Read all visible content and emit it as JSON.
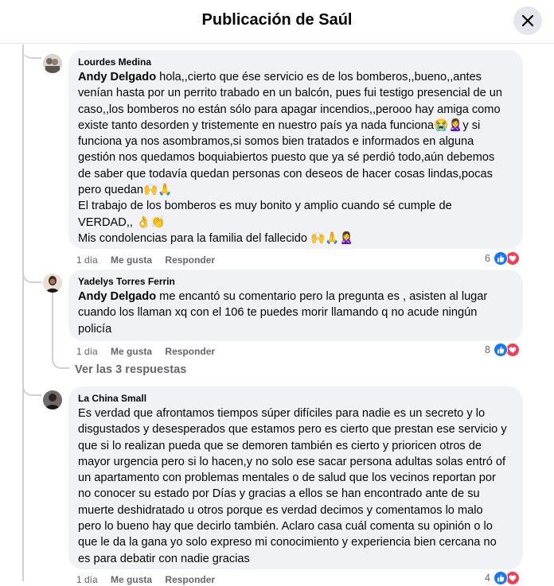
{
  "header": {
    "title": "Publicación de Saúl"
  },
  "comments": [
    {
      "author": "Lourdes Medina",
      "mention": "Andy Delgado",
      "text_lines": [
        " hola,,cierto que ése servicio es de los bomberos,,bueno,,antes",
        "venían hasta por un perrito trabado en un balcón, pues fui testigo presencial de un",
        "caso,,los bomberos no están sólo para apagar incendios,,perooo hay amiga como",
        "existe tanto desorden y tristemente en nuestro país ya nada funciona😭🙎‍♀️y si",
        "funciona ya nos asombramos,si somos bien tratados e informados en alguna",
        "gestión nos quedamos boquiabiertos puesto que ya sé perdió todo,aún debemos",
        "de saber que todavía quedan personas con deseos de hacer cosas lindas,pocas",
        "pero quedan🙌🙏",
        "El trabajo de los bomberos es muy bonito y amplio cuando sé cumple de",
        "VERDAD,, 👌👏",
        "Mis condolencias para la familia del fallecido 🙌🙏🙎‍♀️"
      ],
      "time": "1 día",
      "like_label": "Me gusta",
      "reply_label": "Responder",
      "reaction_count": "6"
    },
    {
      "author": "Yadelys Torres Ferrin",
      "mention": "Andy Delgado",
      "text_lines": [
        " me encantó su comentario pero la pregunta es , asisten al lugar",
        "cuando los llaman xq con el 106 te puedes morir llamando q no acude ningún",
        "policía"
      ],
      "time": "1 día",
      "like_label": "Me gusta",
      "reply_label": "Responder",
      "reaction_count": "8"
    },
    {
      "author": "La China Small",
      "mention": "",
      "text_lines": [
        "Es verdad que afrontamos tiempos súper difíciles para nadie es un secreto y lo",
        "disgustados y desesperados que estamos pero es cierto que prestan ese servicio y",
        "que si lo realizan pueda que se demoren también es cierto y prioricen otros de",
        "mayor urgencia pero si lo hacen,y no solo ese sacar persona adultas solas entró of",
        "un apartamento con problemas mentales o de salud que los vecinos reportan por",
        "no conocer su estado por Días y gracias a ellos se han encontrado ante de su",
        "muerte deshidratado u otros porque es verdad decimos y comentamos lo malo",
        "pero lo bueno hay que decirlo también. Aclaro casa cuál comenta su opinión o lo",
        "que le da la gana yo solo expreso mi conocimiento y experiencia bien cercana no",
        "es para debatir con nadie gracias"
      ],
      "time": "1 día",
      "like_label": "Me gusta",
      "reply_label": "Responder",
      "reaction_count": "4"
    }
  ],
  "view_replies": "Ver las 3 respuestas",
  "colors": {
    "like": "#1877f2",
    "love": "#f33e58",
    "bubble": "#f0f2f5",
    "secondary_text": "#65676b"
  },
  "icons": [
    "close-icon",
    "like-reaction-icon",
    "love-reaction-icon"
  ]
}
